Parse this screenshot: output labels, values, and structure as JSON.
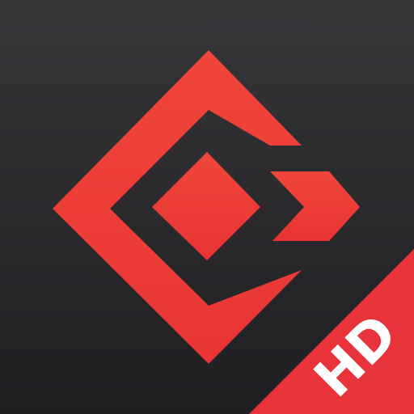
{
  "icon": {
    "badge_text": "HD",
    "icon_name": "diamond-logo-icon",
    "colors": {
      "background_top": "#363639",
      "background_bottom": "#1f1f22",
      "logo_red": "#e83434",
      "logo_red_light": "#f0463a",
      "badge_red": "#e8333a",
      "badge_text": "#ffffff"
    }
  }
}
